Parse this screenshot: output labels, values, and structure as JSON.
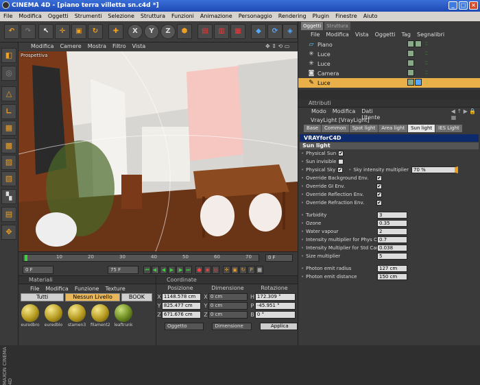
{
  "app": {
    "title": "CINEMA 4D - [piano terra villetta sn.c4d *]"
  },
  "menubar": [
    "File",
    "Modifica",
    "Oggetti",
    "Strumenti",
    "Selezione",
    "Struttura",
    "Funzioni",
    "Animazione",
    "Personaggio",
    "Rendering",
    "Plugin",
    "Finestre",
    "Aiuto"
  ],
  "viewport": {
    "menu": [
      "Modifica",
      "Camere",
      "Mostra",
      "Filtro",
      "Vista"
    ],
    "label": "Prospettiva"
  },
  "timeline": {
    "ticks": [
      "0",
      "10",
      "20",
      "30",
      "40",
      "50",
      "60",
      "70"
    ],
    "frame": "0 F",
    "start": "0 F",
    "end": "75 F"
  },
  "materials": {
    "header": "Materiali",
    "menu": [
      "File",
      "Modifica",
      "Funzione",
      "Texture"
    ],
    "tabs": [
      "Tutti",
      "Nessun Livello",
      "BOOK"
    ],
    "items": [
      "euredbro",
      "euredblo",
      "stamen3",
      "filament2",
      "leaftrunk"
    ]
  },
  "coords": {
    "header": "Coordinate",
    "cols": [
      "Posizione",
      "Dimensione",
      "Rotazione"
    ],
    "rows": [
      {
        "a": "X",
        "p": "1148.578 cm",
        "b": "X",
        "s": "0 cm",
        "c": "H",
        "r": "172.309 °"
      },
      {
        "a": "Y",
        "p": "825.477 cm",
        "b": "Y",
        "s": "0 cm",
        "c": "P",
        "r": "-45.951 °"
      },
      {
        "a": "Z",
        "p": "671.676 cm",
        "b": "Z",
        "s": "0 cm",
        "c": "B",
        "r": "0 °"
      }
    ],
    "mode": "Oggetto",
    "size_mode": "Dimensione",
    "apply": "Applica"
  },
  "objects": {
    "tabs": [
      "Oggetti",
      "Struttura"
    ],
    "menu": [
      "File",
      "Modifica",
      "Vista",
      "Oggetti",
      "Tag",
      "Segnalibri"
    ],
    "items": [
      "Piano",
      "Luce",
      "Luce",
      "Camera",
      "Luce"
    ]
  },
  "attributes": {
    "header": "Attributi",
    "menu": [
      "Modo",
      "Modifica",
      "Dati Utente"
    ],
    "object": "VrayLight [VrayLight]",
    "tabs": [
      "Base",
      "Common",
      "Spot light",
      "Area light",
      "Sun light",
      "IES Light"
    ],
    "active_tab": "Sun light",
    "banner": "VRAYforC4D",
    "section": "Sun light",
    "checks": [
      {
        "label": "Physical Sun",
        "on": "✔"
      },
      {
        "label": "Sun invisible",
        "on": ""
      },
      {
        "label": "Physical Sky",
        "on": "✔"
      },
      {
        "label": "Override Background Env.",
        "on": "✔"
      },
      {
        "label": "Override GI Env.",
        "on": "✔"
      },
      {
        "label": "Override Reflection Env.",
        "on": "✔"
      },
      {
        "label": "Override Refraction Env.",
        "on": "✔"
      }
    ],
    "sky_mult_label": "Sky intensity multiplier",
    "sky_mult": "70 %",
    "values": [
      {
        "label": "Turbidity",
        "value": "3"
      },
      {
        "label": "Ozone",
        "value": "0.35"
      },
      {
        "label": "Water vapour",
        "value": "2"
      },
      {
        "label": "Intensity multiplier for Phys Cam",
        "value": "0.7"
      },
      {
        "label": "Intensity Multiplier for Std Cam",
        "value": "0.038"
      },
      {
        "label": "Size multiplier",
        "value": "5"
      }
    ],
    "photon": [
      {
        "label": "Photon emit radius",
        "value": "127 cm"
      },
      {
        "label": "Photon emit distance",
        "value": "150 cm"
      }
    ]
  },
  "branding": "MAXON CINEMA 4D"
}
